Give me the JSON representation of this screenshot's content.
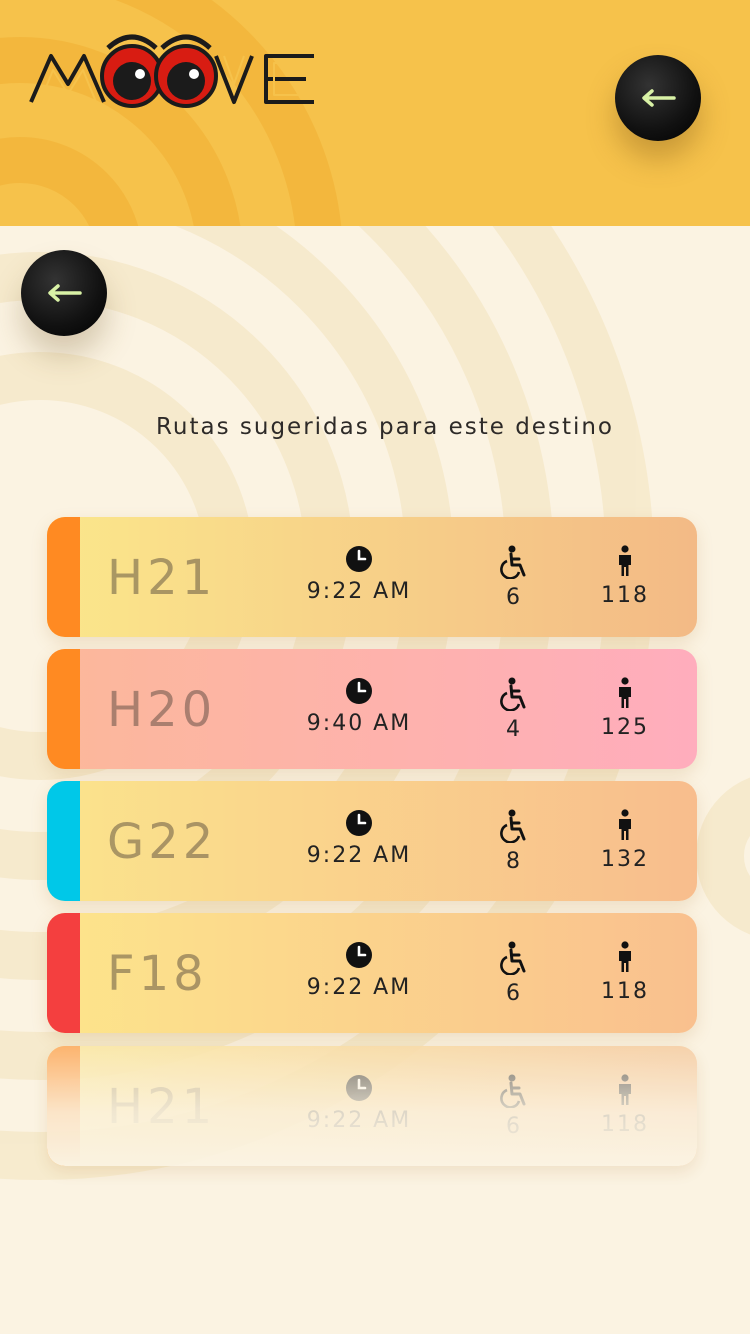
{
  "app": {
    "logo_text": "MOOVE",
    "colors": {
      "header": "#f6c24b",
      "background": "#fbf3e2",
      "fab": "#111111",
      "fab_arrow": "#d9f2a6"
    }
  },
  "header": {
    "back_button_icon": "arrow-left-icon"
  },
  "main": {
    "back_button_icon": "arrow-left-icon",
    "subtitle": "Rutas sugeridas para este destino"
  },
  "routes": [
    {
      "code": "H21",
      "time": "9:22 AM",
      "wheelchair": "6",
      "passengers": "118",
      "strip_color": "#ff8a22",
      "gradient": [
        "#fbe78b",
        "#f3ba86"
      ]
    },
    {
      "code": "H20",
      "time": "9:40 AM",
      "wheelchair": "4",
      "passengers": "125",
      "strip_color": "#ff8a22",
      "gradient": [
        "#fcb89a",
        "#ffadbd"
      ]
    },
    {
      "code": "G22",
      "time": "9:22 AM",
      "wheelchair": "8",
      "passengers": "132",
      "strip_color": "#00c8e8",
      "gradient": [
        "#fbe48c",
        "#f8bd8d"
      ]
    },
    {
      "code": "F18",
      "time": "9:22 AM",
      "wheelchair": "6",
      "passengers": "118",
      "strip_color": "#f43f3f",
      "gradient": [
        "#fde58b",
        "#f9c08e"
      ]
    },
    {
      "code": "H21",
      "time": "9:22 AM",
      "wheelchair": "6",
      "passengers": "118",
      "strip_color": "#ff8a22",
      "gradient": [
        "#fbe78b",
        "#f3ba86"
      ]
    }
  ],
  "icons": {
    "time": "clock-icon",
    "wheelchair": "wheelchair-icon",
    "passengers": "person-icon"
  }
}
